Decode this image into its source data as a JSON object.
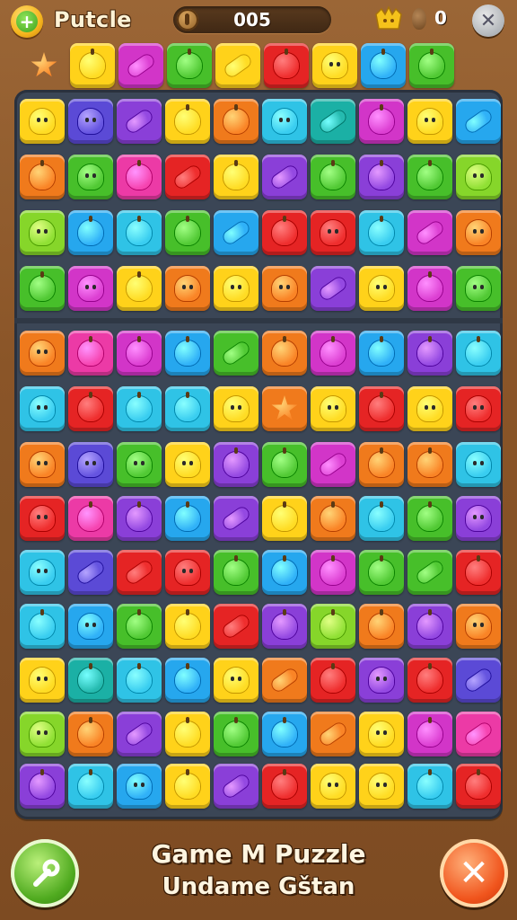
{
  "header": {
    "title": "Putcle",
    "score": "005",
    "moves": "0",
    "plus_icon": "plus-icon",
    "coin_icon": "coin-icon",
    "trophy_icon": "golden-crown-icon",
    "egg_icon": "egg-icon",
    "close_symbol": "✕"
  },
  "footer": {
    "title": "Game M Puzzle",
    "subtitle": "Undame Gštan",
    "back_icon": "wrench-icon",
    "cancel_symbol": "✕"
  },
  "colors": {
    "red": "#e52424",
    "orange": "#f07a1c",
    "yellow": "#ffd21a",
    "green": "#47bf2a",
    "lime": "#86d62a",
    "blue": "#26a7ee",
    "cyan": "#2fc3e6",
    "teal": "#1bb0a5",
    "purple": "#8a3fd8",
    "indigo": "#5b4ad6",
    "pink": "#ec3aa6",
    "magenta": "#d235c8",
    "board": "#3b4656",
    "wood": "#8a5528"
  },
  "boosters": [
    {
      "name": "booster-1",
      "color": "orange",
      "shape": "star"
    },
    {
      "name": "booster-2",
      "color": "yellow",
      "shape": "apple"
    },
    {
      "name": "booster-3",
      "color": "magenta",
      "shape": "candy"
    },
    {
      "name": "booster-4",
      "color": "green",
      "shape": "apple"
    },
    {
      "name": "booster-5",
      "color": "yellow",
      "shape": "candy"
    },
    {
      "name": "booster-6",
      "color": "red",
      "shape": "apple"
    },
    {
      "name": "booster-7",
      "color": "yellow",
      "shape": "blob"
    },
    {
      "name": "booster-8",
      "color": "blue",
      "shape": "apple"
    },
    {
      "name": "booster-9",
      "color": "green",
      "shape": "apple"
    }
  ],
  "grid": [
    [
      "yellow",
      "indigo",
      "purple",
      "yellow",
      "orange",
      "cyan",
      "teal",
      "magenta",
      "yellow",
      "blue"
    ],
    [
      "orange",
      "green",
      "pink",
      "red",
      "yellow",
      "purple",
      "green",
      "purple",
      "green",
      "lime"
    ],
    [
      "lime",
      "blue",
      "cyan",
      "green",
      "blue",
      "red",
      "red",
      "cyan",
      "magenta",
      "orange"
    ],
    [
      "green",
      "magenta",
      "yellow",
      "orange",
      "yellow",
      "orange",
      "purple",
      "yellow",
      "magenta",
      "green"
    ],
    [
      "orange",
      "pink",
      "magenta",
      "blue",
      "green",
      "orange",
      "magenta",
      "blue",
      "purple",
      "cyan"
    ],
    [
      "cyan",
      "red",
      "cyan",
      "cyan",
      "yellow",
      "orange",
      "yellow",
      "red",
      "yellow",
      "red"
    ],
    [
      "orange",
      "indigo",
      "green",
      "yellow",
      "purple",
      "green",
      "magenta",
      "orange",
      "orange",
      "cyan"
    ],
    [
      "red",
      "pink",
      "purple",
      "blue",
      "purple",
      "yellow",
      "orange",
      "cyan",
      "green",
      "purple"
    ],
    [
      "cyan",
      "indigo",
      "red",
      "red",
      "green",
      "blue",
      "magenta",
      "green",
      "green",
      "red"
    ],
    [
      "cyan",
      "blue",
      "green",
      "yellow",
      "red",
      "purple",
      "lime",
      "orange",
      "purple",
      "orange"
    ],
    [
      "yellow",
      "teal",
      "cyan",
      "blue",
      "yellow",
      "orange",
      "red",
      "purple",
      "red",
      "indigo"
    ],
    [
      "lime",
      "orange",
      "purple",
      "yellow",
      "green",
      "blue",
      "orange",
      "yellow",
      "magenta",
      "pink"
    ],
    [
      "purple",
      "cyan",
      "blue",
      "yellow",
      "purple",
      "red",
      "yellow",
      "yellow",
      "cyan",
      "red"
    ]
  ],
  "shapes": [
    [
      "blob",
      "blob",
      "candy",
      "apple",
      "apple",
      "blob",
      "candy",
      "apple",
      "blob",
      "candy"
    ],
    [
      "apple",
      "blob",
      "apple",
      "candy",
      "apple",
      "candy",
      "apple",
      "apple",
      "apple",
      "blob"
    ],
    [
      "blob",
      "apple",
      "apple",
      "apple",
      "candy",
      "apple",
      "blob",
      "apple",
      "candy",
      "blob"
    ],
    [
      "apple",
      "blob",
      "apple",
      "blob",
      "blob",
      "blob",
      "candy",
      "blob",
      "apple",
      "blob"
    ],
    [
      "blob",
      "apple",
      "apple",
      "apple",
      "candy",
      "apple",
      "apple",
      "apple",
      "apple",
      "apple"
    ],
    [
      "blob",
      "apple",
      "apple",
      "apple",
      "blob",
      "star",
      "blob",
      "apple",
      "blob",
      "blob"
    ],
    [
      "blob",
      "blob",
      "blob",
      "blob",
      "apple",
      "apple",
      "candy",
      "apple",
      "apple",
      "blob"
    ],
    [
      "blob",
      "apple",
      "apple",
      "apple",
      "candy",
      "apple",
      "apple",
      "apple",
      "apple",
      "blob"
    ],
    [
      "blob",
      "candy",
      "candy",
      "blob",
      "apple",
      "apple",
      "apple",
      "apple",
      "candy",
      "apple"
    ],
    [
      "apple",
      "blob",
      "apple",
      "apple",
      "candy",
      "apple",
      "apple",
      "apple",
      "apple",
      "blob"
    ],
    [
      "blob",
      "apple",
      "apple",
      "apple",
      "blob",
      "candy",
      "apple",
      "blob",
      "apple",
      "candy"
    ],
    [
      "blob",
      "apple",
      "candy",
      "apple",
      "apple",
      "apple",
      "candy",
      "blob",
      "apple",
      "candy"
    ],
    [
      "apple",
      "apple",
      "blob",
      "apple",
      "candy",
      "apple",
      "blob",
      "blob",
      "apple",
      "apple"
    ]
  ]
}
